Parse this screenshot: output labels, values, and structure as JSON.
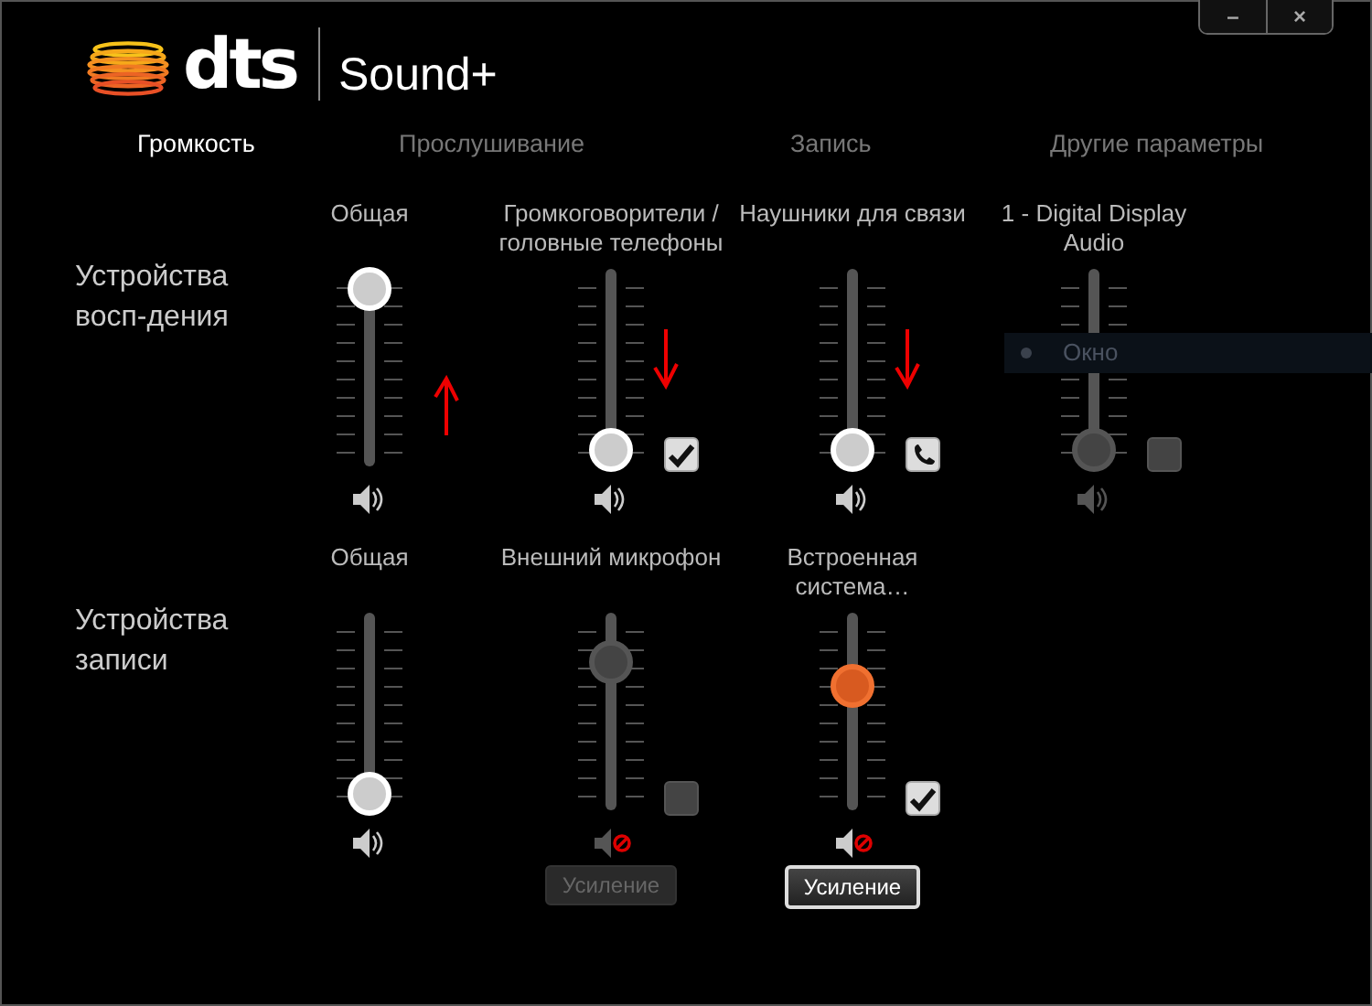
{
  "logo": {
    "brand": "dts",
    "product": "Sound+"
  },
  "window_buttons": [
    "–",
    "×"
  ],
  "tabs": [
    {
      "label": "Громкость",
      "selected": true
    },
    {
      "label": "Прослушивание",
      "selected": false
    },
    {
      "label": "Запись",
      "selected": false
    },
    {
      "label": "Другие параметры",
      "selected": false
    }
  ],
  "sections": [
    {
      "label": "Устройства восп-дения",
      "devices": [
        {
          "name": "Общая",
          "level": 1,
          "disabled": false,
          "muted": false,
          "annotation": {
            "kind": "up"
          }
        },
        {
          "name": "Громкоговорители / головные телефоны",
          "level": 0,
          "disabled": false,
          "muted": false,
          "annotation": {
            "kind": "down"
          },
          "checkbox": {
            "kind": "check",
            "checked": true,
            "disabled": false
          }
        },
        {
          "name": "Наушники для связи",
          "level": 0,
          "disabled": false,
          "muted": false,
          "annotation": {
            "kind": "down"
          },
          "checkbox": {
            "kind": "phone",
            "checked": true,
            "disabled": false
          }
        },
        {
          "name": "1 - Digital Display Audio",
          "level": 0,
          "disabled": true,
          "muted": false,
          "checkbox": {
            "kind": "check",
            "checked": false,
            "disabled": true
          }
        }
      ]
    },
    {
      "label": "Устройства записи",
      "devices": [
        {
          "name": "Общая",
          "level": 0,
          "disabled": false,
          "muted": false
        },
        {
          "name": "Внешний микрофон",
          "level": 0.82,
          "disabled": true,
          "muted": true,
          "checkbox": {
            "kind": "check",
            "checked": false,
            "disabled": true
          },
          "button": {
            "label": "Усиление",
            "disabled": true
          }
        },
        {
          "name": "Встроенная система…",
          "level": 0.67,
          "disabled": false,
          "muted": true,
          "active": true,
          "checkbox": {
            "kind": "check",
            "checked": true,
            "disabled": false
          },
          "button": {
            "label": "Усиление",
            "disabled": false
          }
        }
      ]
    }
  ],
  "overlay": {
    "text": "Окно"
  }
}
